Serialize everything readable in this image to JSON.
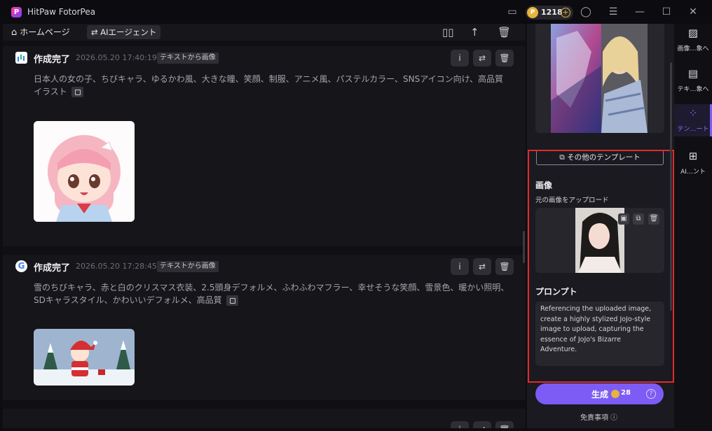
{
  "window": {
    "app_title": "HitPaw FotorPea",
    "coins": "1218",
    "logo_letter": "P"
  },
  "nav": {
    "home": "ホームページ",
    "agent": "AIエージェント"
  },
  "cards": [
    {
      "title": "作成完了",
      "time": "2026.05.20  17:40:19",
      "tag": "テキストから画像",
      "prompt": "日本人の女の子、ちびキャラ、ゆるかわ風、大きな瞳、笑顔、制服、アニメ風、パステルカラー、SNSアイコン向け、高品質イラスト"
    },
    {
      "title": "作成完了",
      "time": "2026.05.20  17:28:45",
      "tag": "テキストから画像",
      "prompt": "雪のちびキャラ、赤と白のクリスマス衣装、2.5頭身デフォルメ、ふわふわマフラー、幸せそうな笑顔、雪景色、暖かい照明、SDキャラスタイル、かわいいデフォルメ、高品質"
    }
  ],
  "right": {
    "more_templates": "その他のテンプレート",
    "image_title": "画像",
    "image_sub": "元の画像をアップロード",
    "prompt_title": "プロンプト",
    "prompt_text": "Referencing the uploaded image, create a highly stylized JoJo-style image to upload, capturing the essence of JoJo's Bizarre Adventure.",
    "generate": "生成",
    "cost": "28",
    "disclaimer": "免責事項 ⓘ"
  },
  "sidebar": [
    {
      "label": "画像…象へ",
      "icon": "image-plus-icon"
    },
    {
      "label": "テキ…象へ",
      "icon": "text-image-icon"
    },
    {
      "label": "テン…ート",
      "icon": "template-grid-icon",
      "active": true
    },
    {
      "label": "AI…ント",
      "icon": "ai-agent-icon"
    }
  ]
}
